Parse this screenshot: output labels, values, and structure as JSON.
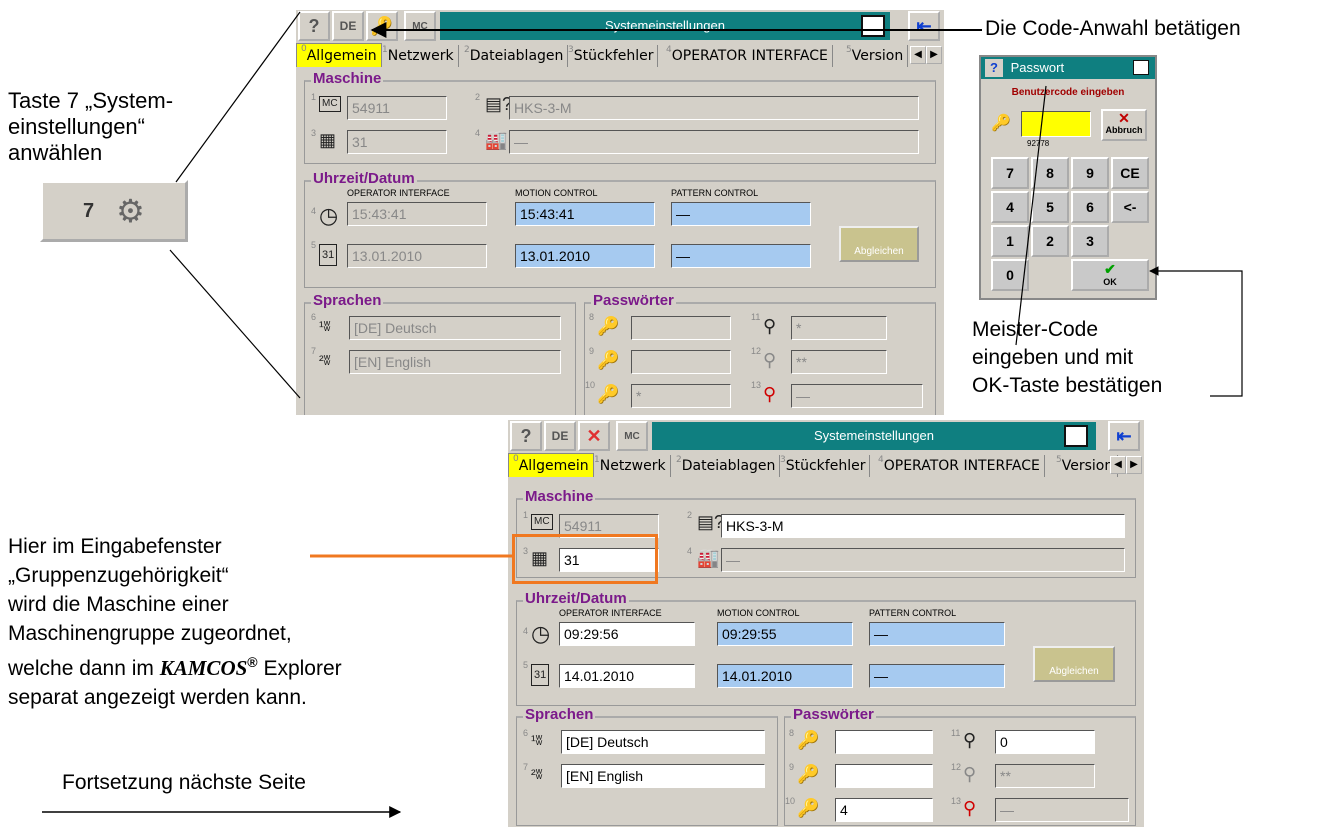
{
  "annotations": {
    "taste7_line1": "Taste 7 „System-",
    "taste7_line2": "einstellungen“",
    "taste7_line3": "anwählen",
    "code_anwahl": "Die Code-Anwahl betätigen",
    "meister_line1": "Meister-Code",
    "meister_line2": "eingeben und mit",
    "meister_line3": "OK-Taste bestätigen",
    "hier_line1": "Hier im Eingabefenster",
    "hier_line2": "„Gruppenzugehörigkeit“",
    "hier_line3": "wird die Maschine einer",
    "hier_line4": "Maschinengruppe zugeordnet,",
    "hier_line5a": "welche dann im ",
    "hier_brand": "KAMCOS",
    "hier_reg": "®",
    "hier_line5b": " Explorer",
    "hier_line6": "separat angezeigt werden kann.",
    "fortsetzung": "Fortsetzung nächste Seite"
  },
  "taste7_button": {
    "number": "7"
  },
  "password_dialog": {
    "title": "Passwort",
    "prompt": "Benutzercode eingeben",
    "code_hint": "92778",
    "cancel_label": "Abbruch",
    "ok_label": "OK",
    "keys": [
      "7",
      "8",
      "9",
      "CE",
      "4",
      "5",
      "6",
      "<-",
      "1",
      "2",
      "3",
      "0"
    ]
  },
  "window_top": {
    "title": "Systemeinstellungen",
    "tabs": [
      "Allgemein",
      "Netzwerk",
      "Dateiablagen",
      "Stückfehler",
      "OPERATOR INTERFACE",
      "Version"
    ],
    "tab_numbers": [
      "0",
      "1",
      "2",
      "3",
      "4",
      "5"
    ],
    "group_maschine": "Maschine",
    "group_uhrzeit": "Uhrzeit/Datum",
    "group_sprachen": "Sprachen",
    "group_passwoerter": "Passwörter",
    "machine_number": "54911",
    "machine_type": "HKS-3-M",
    "group_membership": "31",
    "location": "—",
    "col_operator": "OPERATOR INTERFACE",
    "col_motion": "MOTION CONTROL",
    "col_pattern": "PATTERN CONTROL",
    "time_oi": "15:43:41",
    "time_mc": "15:43:41",
    "time_pc": "—",
    "date_oi": "13.01.2010",
    "date_mc": "13.01.2010",
    "date_pc": "—",
    "sync_button": "Abgleichen",
    "lang1": "[DE] Deutsch",
    "lang2": "[EN] English",
    "pw8": "",
    "pw9": "",
    "pw10": "*",
    "pw11": "*",
    "pw12": "**",
    "pw13": "—",
    "field_numbers": {
      "n1": "1",
      "n2": "2",
      "n3": "3",
      "n4": "4",
      "n4t": "4",
      "n5": "5",
      "n6": "6",
      "n7": "7",
      "n8": "8",
      "n9": "9",
      "n10": "10",
      "n11": "11",
      "n12": "12",
      "n13": "13"
    }
  },
  "window_bottom": {
    "title": "Systemeinstellungen",
    "tabs": [
      "Allgemein",
      "Netzwerk",
      "Dateiablagen",
      "Stückfehler",
      "OPERATOR INTERFACE",
      "Version"
    ],
    "tab_numbers": [
      "0",
      "1",
      "2",
      "3",
      "4",
      "5"
    ],
    "group_maschine": "Maschine",
    "group_uhrzeit": "Uhrzeit/Datum",
    "group_sprachen": "Sprachen",
    "group_passwoerter": "Passwörter",
    "machine_number": "54911",
    "machine_type": "HKS-3-M",
    "group_membership": "31",
    "location": "—",
    "col_operator": "OPERATOR INTERFACE",
    "col_motion": "MOTION CONTROL",
    "col_pattern": "PATTERN CONTROL",
    "time_oi": "09:29:56",
    "time_mc": "09:29:55",
    "time_pc": "—",
    "date_oi": "14.01.2010",
    "date_mc": "14.01.2010",
    "date_pc": "—",
    "sync_button": "Abgleichen",
    "lang1": "[DE] Deutsch",
    "lang2": "[EN] English",
    "pw8": "",
    "pw9": "",
    "pw10": "4",
    "pw11": "0",
    "pw12": "**",
    "pw13": "—",
    "field_numbers": {
      "n1": "1",
      "n2": "2",
      "n3": "3",
      "n4": "4",
      "n4t": "4",
      "n5": "5",
      "n6": "6",
      "n7": "7",
      "n8": "8",
      "n9": "9",
      "n10": "10",
      "n11": "11",
      "n12": "12",
      "n13": "13"
    }
  },
  "colors": {
    "titlebar": "#0f7f80",
    "active_tab": "#ffff00",
    "group_label": "#7b1a8a",
    "highlight": "#f07820",
    "blue_field": "#a6caf0"
  }
}
